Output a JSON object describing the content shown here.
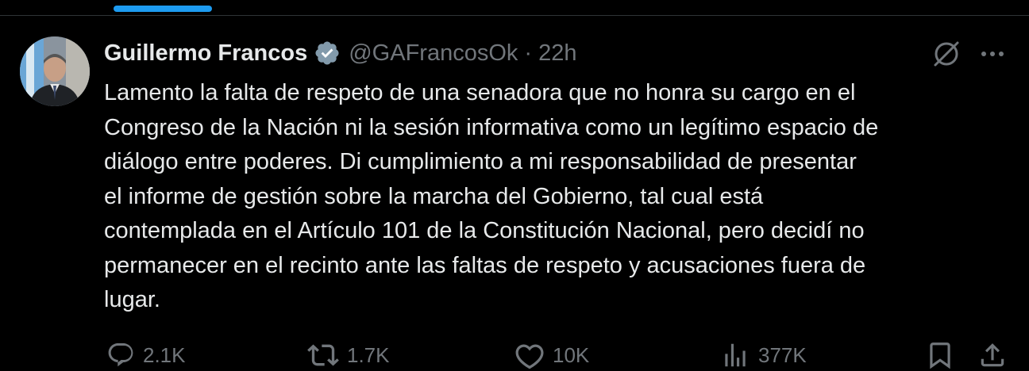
{
  "author": {
    "display_name": "Guillermo Francos",
    "handle": "@GAFrancosOk",
    "separator": "·",
    "time": "22h",
    "verified": true
  },
  "tweet": {
    "lines": [
      "Lamento la falta de respeto de una senadora que no honra su cargo en el",
      "Congreso de la Nación ni la sesión informativa como un legítimo espacio de",
      "diálogo entre poderes. Di cumplimiento a mi responsabilidad de presentar",
      "el informe de gestión sobre la marcha del Gobierno, tal cual está",
      "contemplada en el Artículo 101 de la Constitución Nacional, pero decidí no",
      "permanecer en el recinto ante las faltas de respeto y acusaciones fuera de",
      "lugar."
    ]
  },
  "stats": {
    "replies": "2.1K",
    "reposts": "1.7K",
    "likes": "10K",
    "views": "377K"
  },
  "icons": {
    "verified": "verified-badge-icon",
    "grok": "grok-icon",
    "more": "more-icon",
    "reply": "reply-icon",
    "repost": "repost-icon",
    "like": "like-icon",
    "views": "views-icon",
    "bookmark": "bookmark-icon",
    "share": "share-icon"
  },
  "colors": {
    "background": "#000000",
    "text": "#e7e9ea",
    "secondary": "#71767b",
    "accent": "#1d9bf0"
  }
}
